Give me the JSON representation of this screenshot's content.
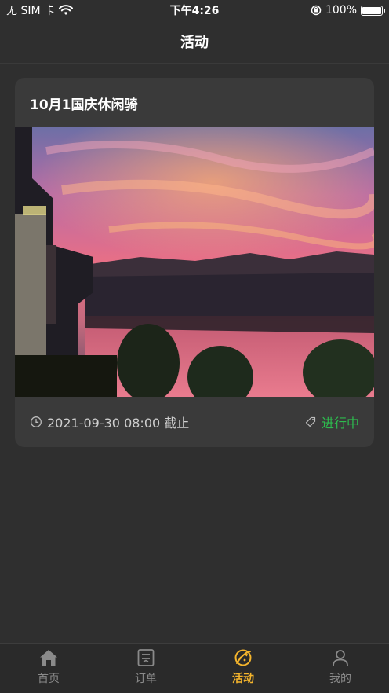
{
  "status_bar": {
    "carrier": "无 SIM 卡",
    "time": "下午4:26",
    "battery": "100%"
  },
  "nav": {
    "title": "活动"
  },
  "activity_card": {
    "title": "10月1国庆休闲骑",
    "deadline": "2021-09-30 08:00 截止",
    "status": "进行中"
  },
  "tab_bar": {
    "items": [
      {
        "label": "首页",
        "icon": "home-icon"
      },
      {
        "label": "订单",
        "icon": "order-icon"
      },
      {
        "label": "活动",
        "icon": "activity-icon",
        "active": true
      },
      {
        "label": "我的",
        "icon": "profile-icon"
      }
    ]
  },
  "colors": {
    "background": "#2f2f2f",
    "card": "#3a3a3a",
    "accent": "#f5b52c",
    "status_green": "#2dbb4e"
  }
}
